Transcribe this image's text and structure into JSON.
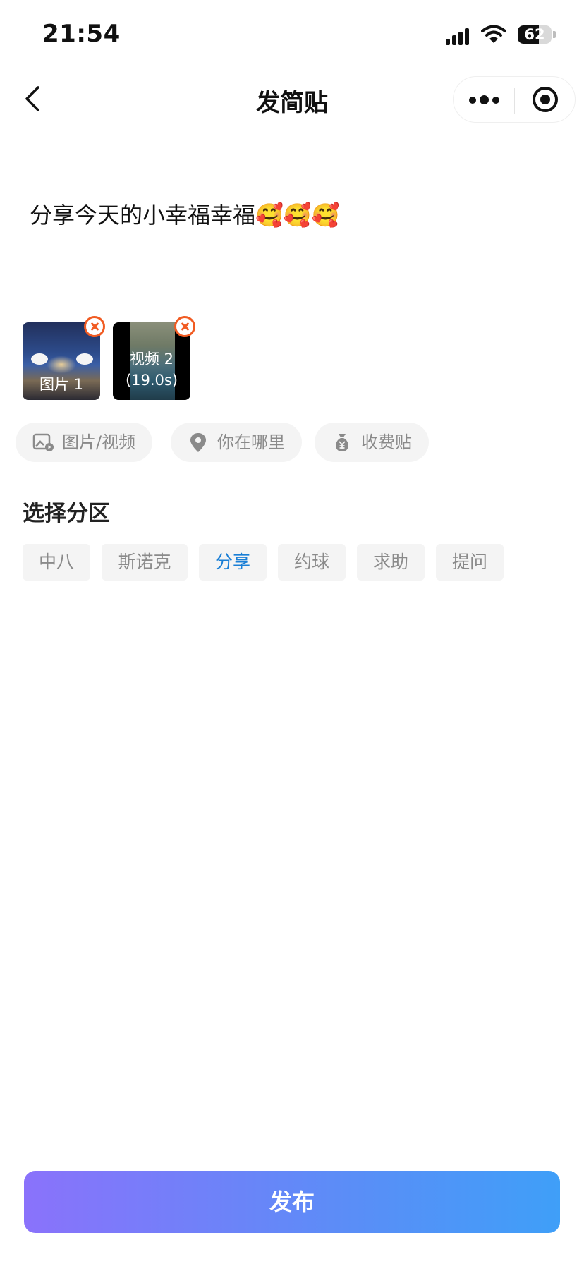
{
  "status_bar": {
    "time": "21:54",
    "battery": "62",
    "battery_level": 0.62
  },
  "nav": {
    "title": "发简贴"
  },
  "post": {
    "text": "分享今天的小幸福幸福🥰🥰🥰"
  },
  "media": [
    {
      "label": "图片 1"
    },
    {
      "label_line1": "视频 2",
      "label_line2": "(19.0s)"
    }
  ],
  "actions": [
    {
      "label": "图片/视频",
      "icon": "image-video-icon"
    },
    {
      "label": "你在哪里",
      "icon": "location-pin-icon"
    },
    {
      "label": "收费贴",
      "icon": "money-bag-icon"
    }
  ],
  "section": {
    "title": "选择分区"
  },
  "categories": [
    {
      "label": "中八",
      "selected": false
    },
    {
      "label": "斯诺克",
      "selected": false
    },
    {
      "label": "分享",
      "selected": true
    },
    {
      "label": "约球",
      "selected": false
    },
    {
      "label": "求助",
      "selected": false
    },
    {
      "label": "提问",
      "selected": false
    }
  ],
  "publish": {
    "label": "发布"
  },
  "colors": {
    "accent": "#1a7fd6",
    "remove": "#f15b22",
    "gradient_start": "#8a72fb",
    "gradient_end": "#3f9ff8"
  }
}
